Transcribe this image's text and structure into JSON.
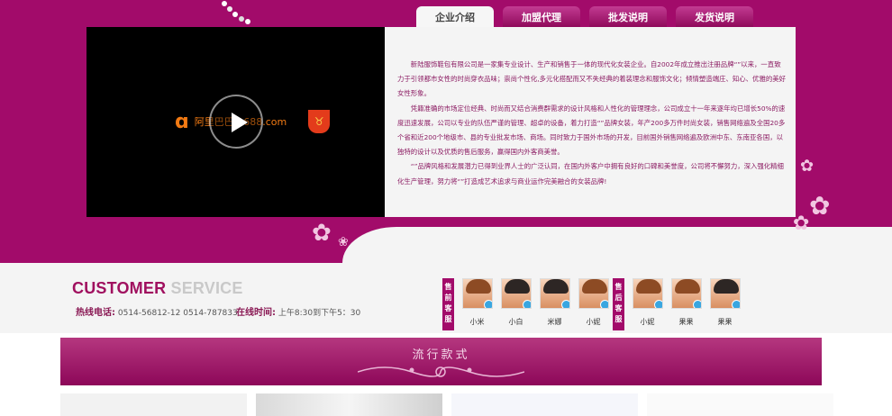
{
  "tabs": [
    {
      "label": "企业介绍",
      "active": true
    },
    {
      "label": "加盟代理",
      "active": false
    },
    {
      "label": "批发说明",
      "active": false
    },
    {
      "label": "发货说明",
      "active": false
    }
  ],
  "video": {
    "logo_text": "阿里巴巴",
    "logo_subtext": "1688.com"
  },
  "intro": {
    "paragraphs": [
      "新陆服饰鞋包有限公司是一家集专业设计、生产和销售于一体的现代化女装企业。自2002年成立推出注册品牌“”以来，一直致力于引领都市女性的时尚穿衣品味；崇尚个性化,多元化搭配而又不失经典的着装理念和服饰文化；倾情塑造端庄、知心、优雅的美好女性形象。",
      "凭籍准确的市场定位经典、时尚而又结合消费群需求的设计风格和人性化的管理理念，公司成立十一年来逐年均已增长50%的速度迅速发展，公司以专业的队伍严谨的管理、超卓的设备，着力打造“”品牌女装，年产200多万件时尚女装，销售网络遍及全国20多个省和近200个地级市、县的专业批发市场、商场。同时致力于国外市场的开发，目前国外销售网络遍及欧洲中东、东南亚各国，以独特的设计以及优质的售后服务，赢得国内外客商美誉。",
      "“”品牌风格和发展潜力已得到业界人士的广泛认同，在国内外客户中拥有良好的口碑和美誉度，公司将不懈努力，深入强化精细化生产管理，努力将“”打造成艺术追求与商业运作完美融合的女装品牌!"
    ]
  },
  "service": {
    "title_part1": "CUSTOMER",
    "title_part2": "SERVICE",
    "hotline_label": "热线电话:",
    "hotline_value": "0514-56812-12 0514-787833",
    "online_label": "在线时间:",
    "online_value": "上午8:30到下午5：30",
    "presale_label": "售前客服",
    "presale_agents": [
      "小米",
      "小白",
      "米娜",
      "小妮"
    ],
    "aftersale_label": "售后客服",
    "aftersale_agents": [
      "小妮",
      "果果",
      "果果"
    ]
  },
  "banner": {
    "title": "流行款式"
  },
  "colors": {
    "brand": "#a20b6a",
    "text_intro": "#8b1b62"
  }
}
